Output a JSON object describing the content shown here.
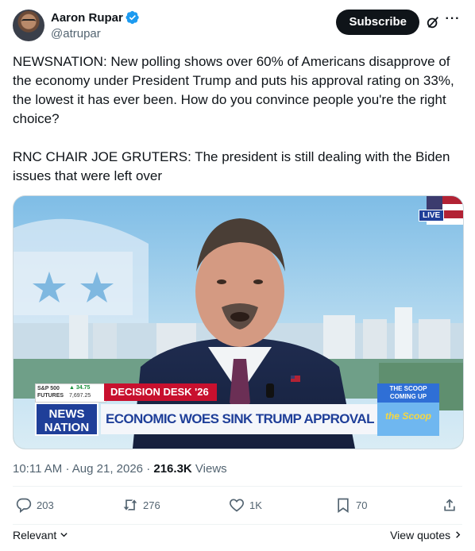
{
  "author": {
    "display_name": "Aaron Rupar",
    "handle": "@atrupar"
  },
  "header": {
    "subscribe_label": "Subscribe"
  },
  "tweet": {
    "text": "NEWSNATION: New polling shows over 60% of Americans disapprove of the economy under President Trump and puts his approval rating on 33%, the lowest it has ever been. How do you convince people you're the right choice?\n\nRNC CHAIR JOE GRUTERS: The president is still dealing with the Biden issues that were left over"
  },
  "media": {
    "live_badge": "LIVE",
    "ticker_label": "S&P 500\nFUTURES",
    "ticker_change": "▲ 34.75",
    "ticker_value": "7,697.25",
    "decision_desk": "DECISION DESK '26",
    "network_logo": "NEWS\nNATION",
    "headline": "ECONOMIC WOES SINK TRUMP APPROVAL RATING",
    "scoop_label": "THE SCOOP\nCOMING UP",
    "scoop_logo": "the Scoop"
  },
  "meta": {
    "time": "10:11 AM",
    "date": "Aug 21, 2026",
    "views_count": "216.3K",
    "views_label": " Views"
  },
  "actions": {
    "replies": "203",
    "reposts": "276",
    "likes": "1K",
    "bookmarks": "70"
  },
  "footer": {
    "sort_label": "Relevant",
    "view_quotes_label": "View quotes"
  },
  "colors": {
    "brand_blue": "#1d9bf0",
    "text_primary": "#0f1419",
    "text_secondary": "#536471",
    "decision_red": "#c8102e",
    "newsnation_blue": "#1f3f99"
  },
  "icons": [
    "verified-icon",
    "grok-icon",
    "more-icon",
    "reply-icon",
    "repost-icon",
    "like-icon",
    "bookmark-icon",
    "share-icon",
    "chevron-down-icon",
    "chevron-right-icon"
  ]
}
